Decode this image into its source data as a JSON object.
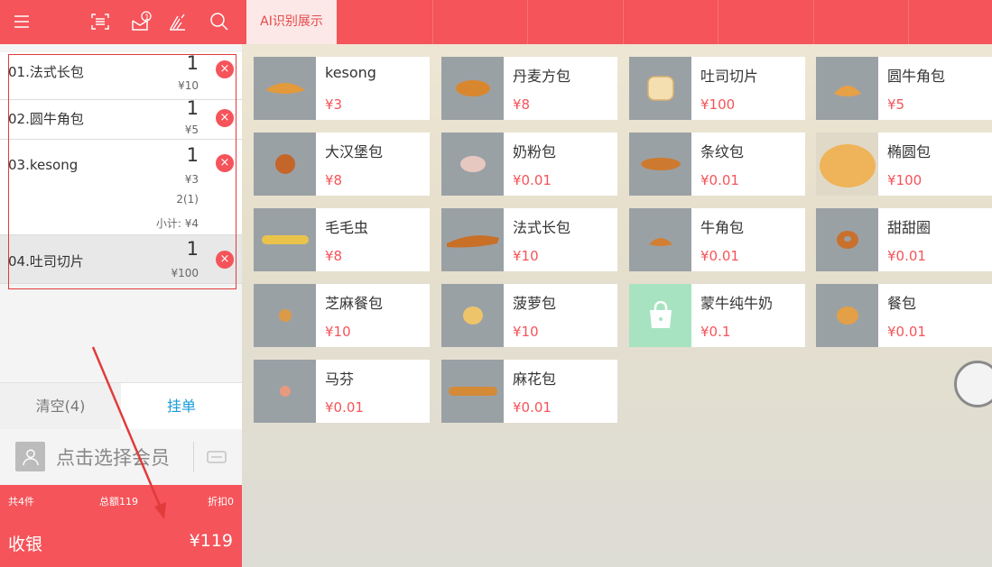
{
  "toolbar": {
    "icons": [
      "menu-icon",
      "scan-icon",
      "message-icon",
      "sign-icon",
      "search-icon"
    ],
    "message_badge": "1"
  },
  "tabs": [
    "AI识别展示"
  ],
  "cart": {
    "items": [
      {
        "name": "01.法式长包",
        "qty": "1",
        "price": "¥10"
      },
      {
        "name": "02.圆牛角包",
        "qty": "1",
        "price": "¥5"
      },
      {
        "name": "03.kesong",
        "qty": "1",
        "price": "¥3",
        "extra": "2(1)",
        "subtotal": "小计: ¥4"
      },
      {
        "name": "04.吐司切片",
        "qty": "1",
        "price": "¥100"
      }
    ],
    "delete_symbol": "×"
  },
  "actions": {
    "clear": "清空(4)",
    "hang": "挂单"
  },
  "member": {
    "label": "点击选择会员"
  },
  "summary": {
    "count": "共4件",
    "total": "总额119",
    "discount": "折扣0"
  },
  "checkout": {
    "label": "收银",
    "amount": "¥119"
  },
  "products": [
    {
      "name": "kesong",
      "price": "¥3"
    },
    {
      "name": "丹麦方包",
      "price": "¥8"
    },
    {
      "name": "吐司切片",
      "price": "¥100"
    },
    {
      "name": "圆牛角包",
      "price": "¥5"
    },
    {
      "name": "大汉堡包",
      "price": "¥8"
    },
    {
      "name": "奶粉包",
      "price": "¥0.01"
    },
    {
      "name": "条纹包",
      "price": "¥0.01"
    },
    {
      "name": "椭圆包",
      "price": "¥100"
    },
    {
      "name": "毛毛虫",
      "price": "¥8"
    },
    {
      "name": "法式长包",
      "price": "¥10"
    },
    {
      "name": "牛角包",
      "price": "¥0.01"
    },
    {
      "name": "甜甜圈",
      "price": "¥0.01"
    },
    {
      "name": "芝麻餐包",
      "price": "¥10"
    },
    {
      "name": "菠萝包",
      "price": "¥10"
    },
    {
      "name": "蒙牛纯牛奶",
      "price": "¥0.1"
    },
    {
      "name": "餐包",
      "price": "¥0.01"
    },
    {
      "name": "马芬",
      "price": "¥0.01"
    },
    {
      "name": "麻花包",
      "price": "¥0.01"
    }
  ],
  "colors": {
    "accent": "#f4545a",
    "link": "#1a9bd8"
  }
}
